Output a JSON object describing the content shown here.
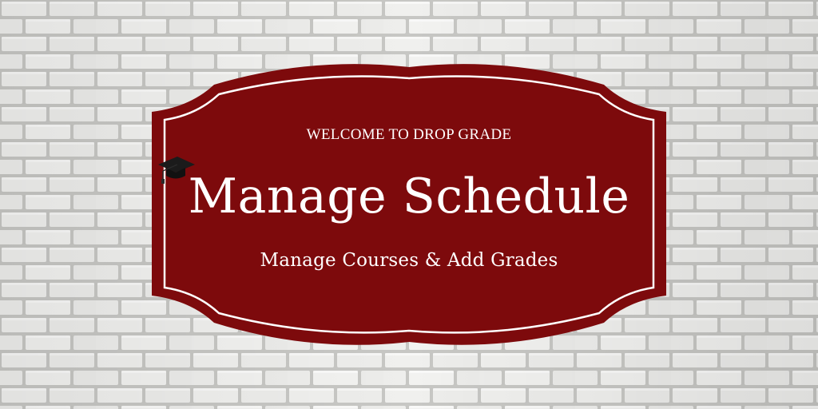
{
  "banner": {
    "kicker": "WELCOME TO DROP GRADE",
    "title": "Manage Schedule",
    "subtitle": "Manage Courses & Add Grades"
  },
  "icons": {
    "cap": "graduation-cap-icon"
  },
  "colors": {
    "sign_fill": "#7d0a0c",
    "sign_border": "#ffffff",
    "text": "#ffffff",
    "brick": "#f1f1ef",
    "mortar": "#c5c5c2"
  }
}
